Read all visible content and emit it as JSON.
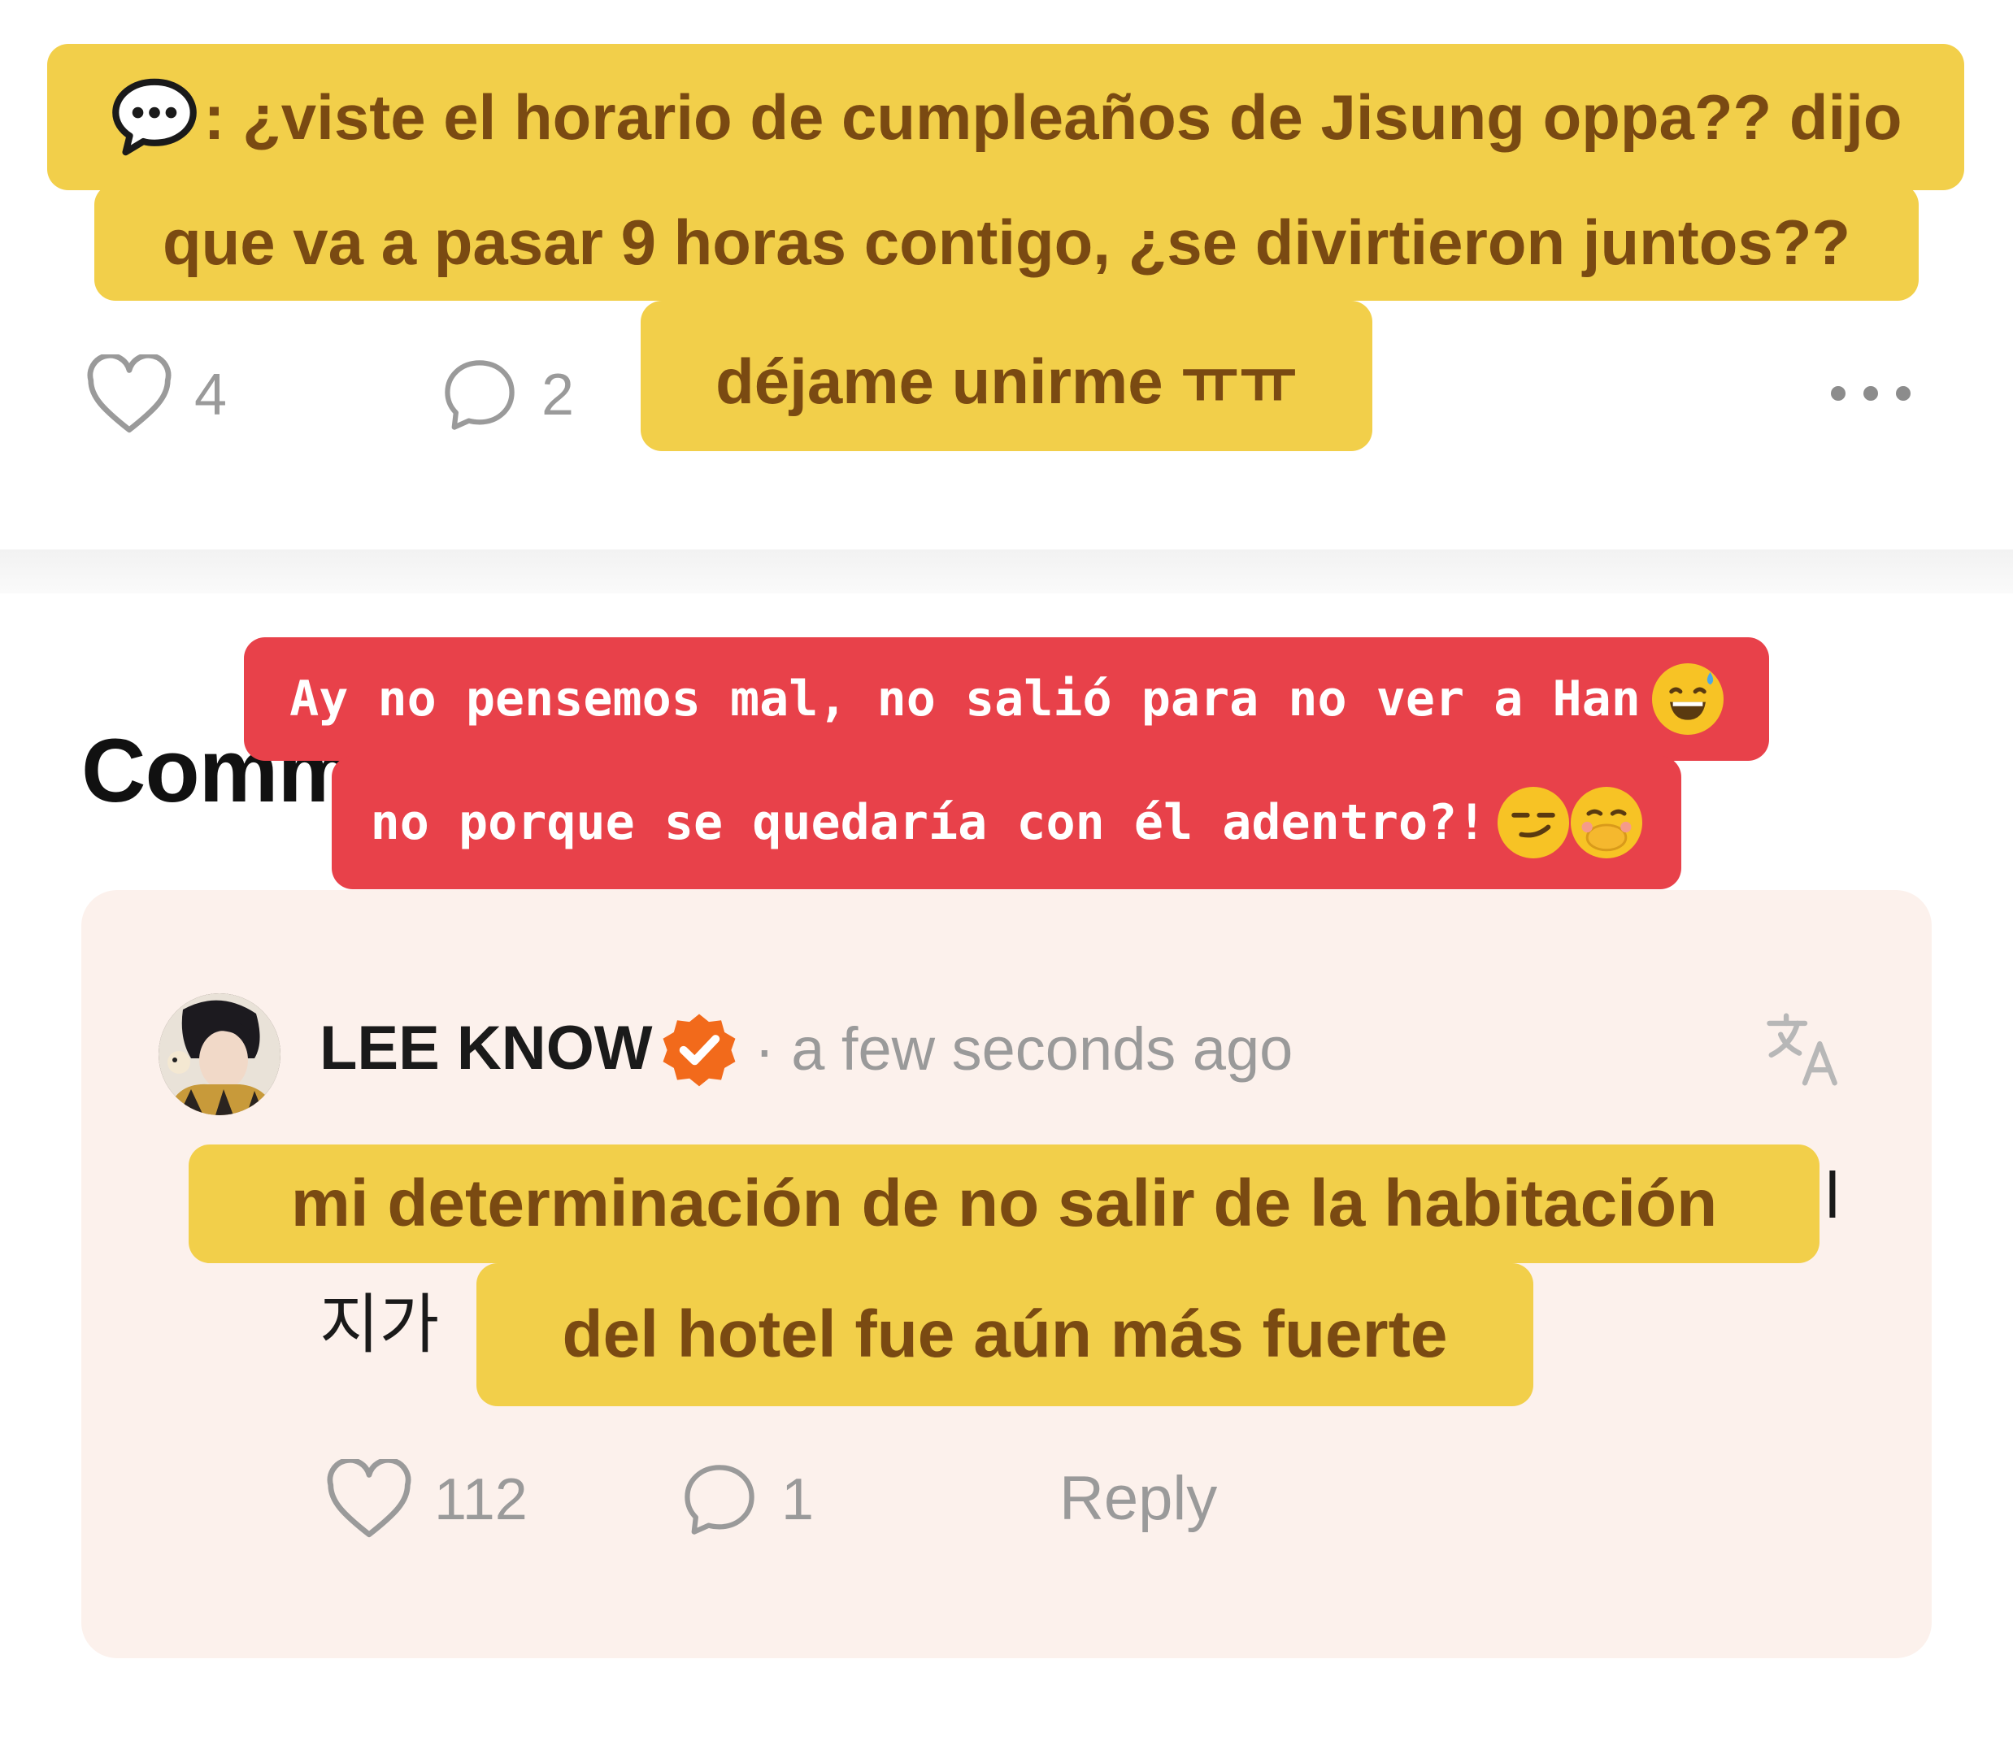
{
  "post": {
    "like_count": "4",
    "comment_count": "2",
    "caption": {
      "icon": "speech-bubble-icon",
      "line1": ": ¿viste el horario de cumpleaños de Jisung oppa?? dijo",
      "line2": "que va a pasar 9 horas contigo, ¿se divirtieron juntos??",
      "line3": "déjame unirme ㅠㅠ"
    }
  },
  "comments_section": {
    "heading": "Comm",
    "red_caption": {
      "line1": "Ay no pensemos mal, no salió para no ver a Han",
      "line2": "no porque se quedaría con él adentro?!"
    }
  },
  "comment": {
    "author": "LEE KNOW",
    "timestamp": "· a few seconds ago",
    "korean_fragment_left": "지가",
    "korean_fragment_right": "l",
    "caption": {
      "line1": "mi determinación de no salir de la habitación",
      "line2": "del hotel fue aún más fuerte"
    },
    "like_count": "112",
    "reply_count": "1",
    "reply_label": "Reply"
  },
  "colors": {
    "caption_yellow": "#f2cf4a",
    "caption_red": "#e8414a",
    "verified_orange": "#f26a1b",
    "card_bg": "#fcf1ec"
  }
}
